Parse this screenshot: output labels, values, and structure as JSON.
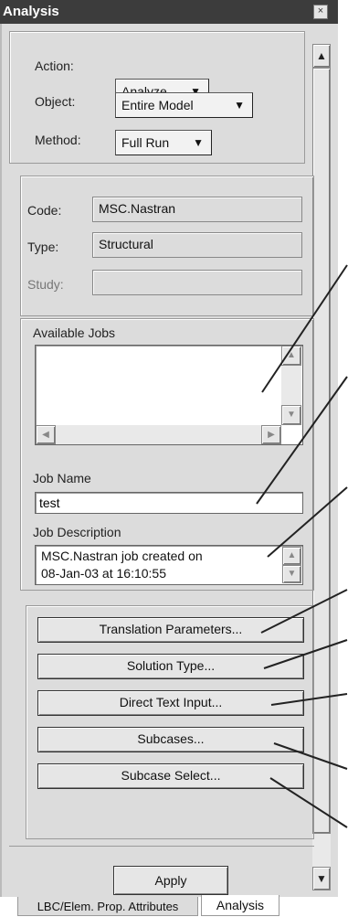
{
  "window": {
    "title": "Analysis",
    "close_icon": "close-icon"
  },
  "form": {
    "action": {
      "label": "Action:",
      "value": "Analyze"
    },
    "object": {
      "label": "Object:",
      "value": "Entire Model"
    },
    "method": {
      "label": "Method:",
      "value": "Full Run"
    }
  },
  "info": {
    "code": {
      "label": "Code:",
      "value": "MSC.Nastran"
    },
    "type": {
      "label": "Type:",
      "value": "Structural"
    },
    "study": {
      "label": "Study:",
      "value": ""
    }
  },
  "jobs": {
    "available_label": "Available Jobs",
    "job_name_label": "Job Name",
    "job_name_value": "test",
    "description_label": "Job Description",
    "description_line1": "MSC.Nastran job created on",
    "description_line2": "08-Jan-03 at 16:10:55"
  },
  "buttons": {
    "translation": "Translation Parameters...",
    "solution": "Solution Type...",
    "direct": "Direct Text Input...",
    "subcases": "Subcases...",
    "subcase_select": "Subcase Select...",
    "apply": "Apply"
  },
  "tabs": {
    "lbc": "LBC/Elem. Prop. Attributes",
    "analysis": "Analysis"
  },
  "icons": {
    "dropdown": "triangle-down-icon",
    "scroll_up": "arrow-up-icon",
    "scroll_down": "arrow-down-icon",
    "scroll_left": "arrow-left-icon",
    "scroll_right": "arrow-right-icon"
  }
}
